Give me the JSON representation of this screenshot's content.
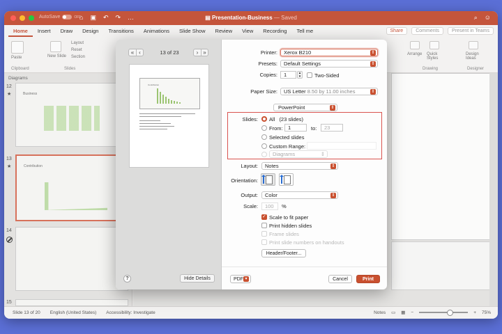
{
  "window": {
    "title": "Presentation-Business",
    "saved": "— Saved",
    "autosave_label": "AutoSave",
    "toggle_state": "OFF"
  },
  "ribbon": {
    "tabs": [
      "Home",
      "Insert",
      "Draw",
      "Design",
      "Transitions",
      "Animations",
      "Slide Show",
      "Review",
      "View",
      "Recording",
      "Tell me"
    ],
    "share_label": "Share",
    "comments_label": "Comments",
    "present_label": "Present in Teams",
    "groups": {
      "paste": "Paste",
      "clipboard": "Clipboard",
      "new_slide": "New Slide",
      "slides": "Slides",
      "layout": "Layout",
      "reset": "Reset",
      "section": "Section",
      "arrange": "Arrange",
      "quick_styles": "Quick Styles",
      "drawing": "Drawing",
      "design_ideas": "Design Ideas",
      "designer": "Designer"
    }
  },
  "left_pane": {
    "header": "Diagrams",
    "slides": [
      {
        "num": "12",
        "title": "Business"
      },
      {
        "num": "13",
        "title": "Contribution"
      },
      {
        "num": "14",
        "title": ""
      },
      {
        "num": "15",
        "title": ""
      }
    ]
  },
  "status_bar": {
    "slide_info": "Slide 13 of 20",
    "language": "English (United States)",
    "accessibility": "Accessibility: Investigate",
    "notes": "Notes",
    "zoom": "75%"
  },
  "print_dialog": {
    "page_counter": "13 of 23",
    "preview_slide_title": "Contribution",
    "printer_label": "Printer:",
    "printer_value": "Xerox B210",
    "presets_label": "Presets:",
    "presets_value": "Default Settings",
    "copies_label": "Copies:",
    "copies_value": "1",
    "two_sided_label": "Two-Sided",
    "paper_size_label": "Paper Size:",
    "paper_size_value": "US Letter",
    "paper_size_dims": "8.50 by 11.00 inches",
    "app_section": "PowerPoint",
    "slides_label": "Slides:",
    "all_label": "All",
    "all_count": "(23 slides)",
    "from_label": "From:",
    "from_value": "1",
    "to_label": "to:",
    "to_value": "23",
    "selected_slides_label": "Selected slides",
    "custom_range_label": "Custom Range:",
    "section_value": "Diagrams",
    "layout_label": "Layout:",
    "layout_value": "Notes",
    "orientation_label": "Orientation:",
    "output_label": "Output:",
    "output_value": "Color",
    "scale_label": "Scale:",
    "scale_value": "100",
    "scale_unit": "%",
    "scale_to_fit_label": "Scale to fit paper",
    "print_hidden_label": "Print hidden slides",
    "frame_slides_label": "Frame slides",
    "print_numbers_label": "Print slide numbers on handouts",
    "header_footer_label": "Header/Footer...",
    "help_label": "?",
    "hide_details_label": "Hide Details",
    "pdf_label": "PDF",
    "cancel_label": "Cancel",
    "print_label": "Print",
    "accent_color": "#c9502f",
    "highlight_color": "#d9534f"
  }
}
